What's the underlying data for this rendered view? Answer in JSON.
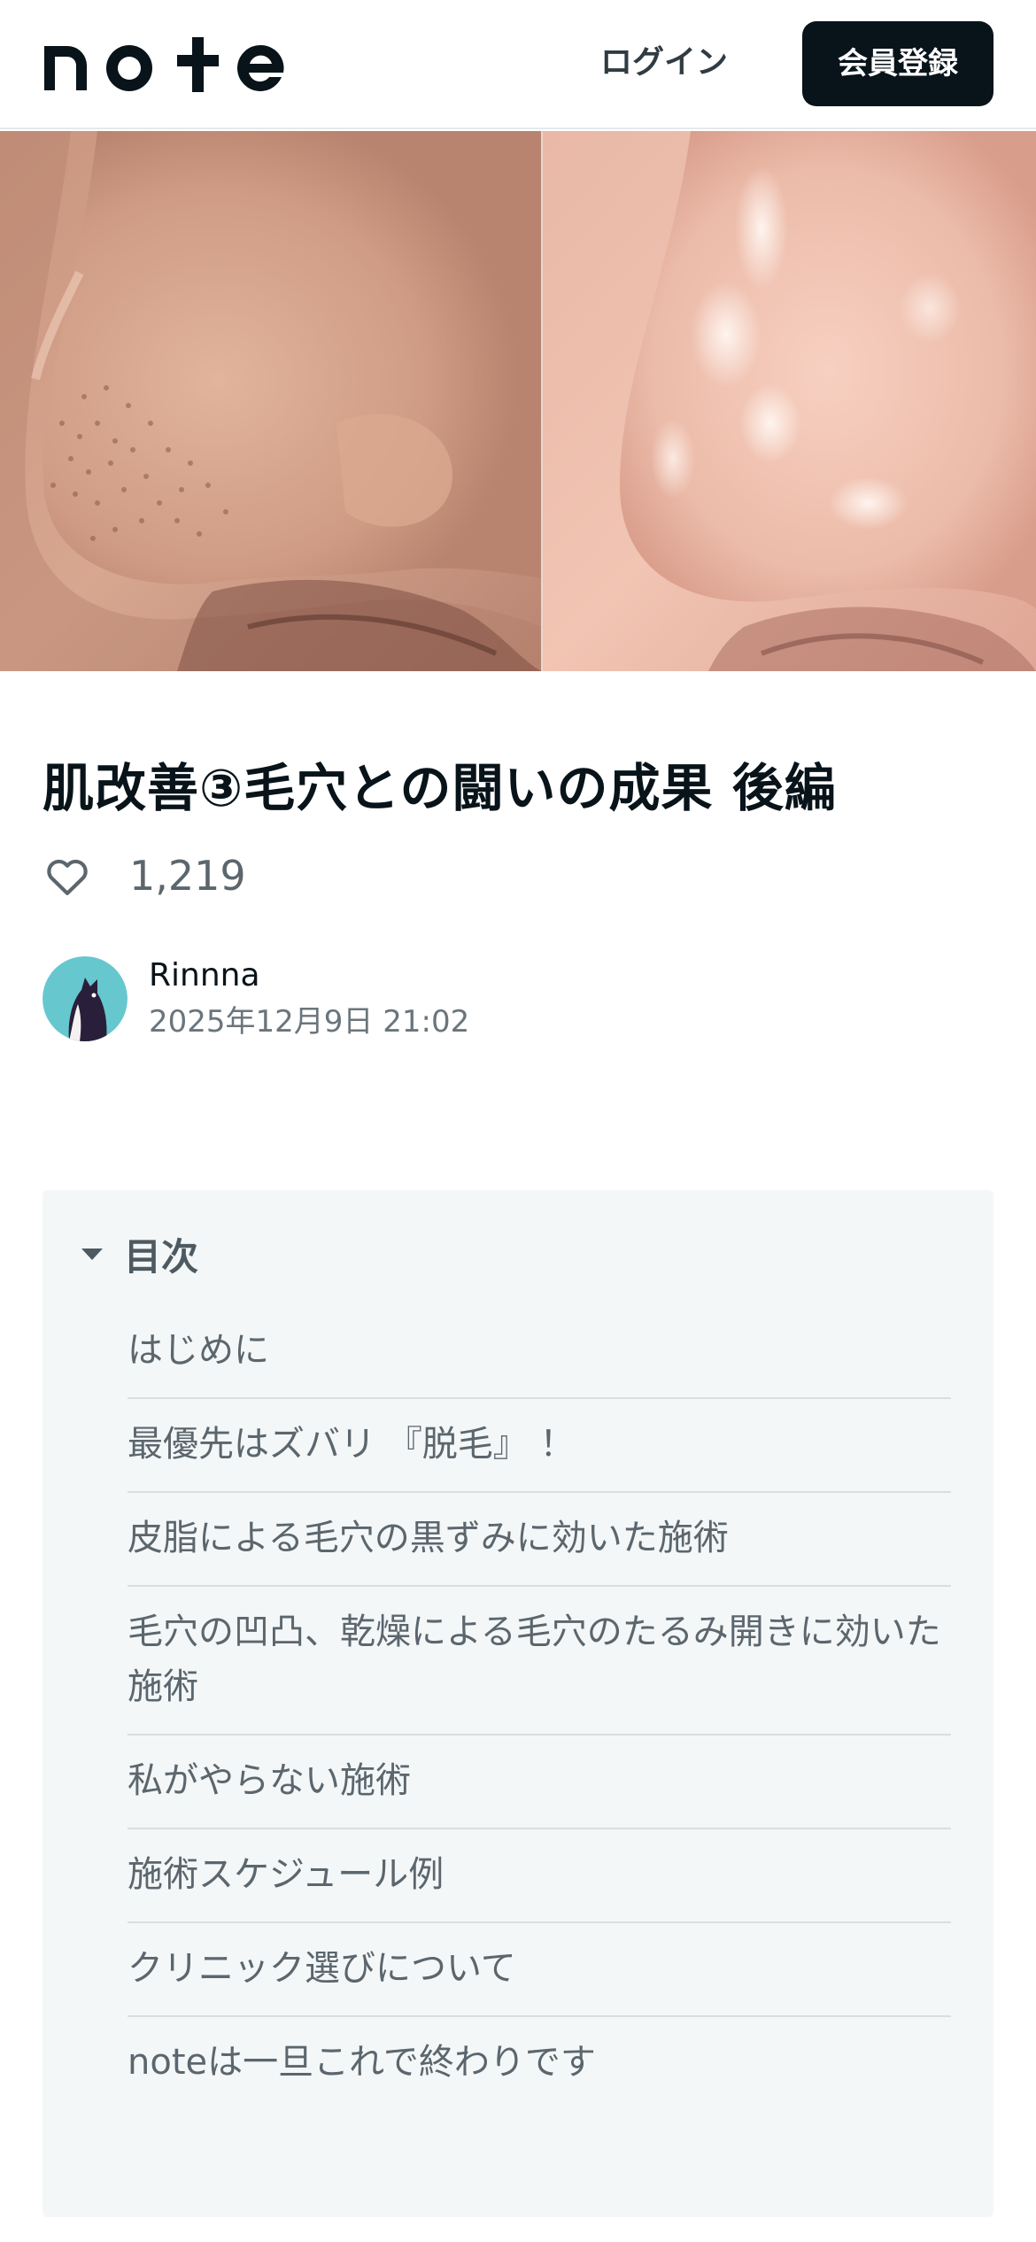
{
  "header": {
    "logo_text": "note",
    "login_label": "ログイン",
    "signup_label": "会員登録"
  },
  "hero": {
    "description_icon": "nose-before-after-photo"
  },
  "article": {
    "title": "肌改善③毛穴との闘いの成果 後編",
    "like_count": "1,219",
    "author_name": "Rinnna",
    "published": "2025年12月9日 21:02"
  },
  "toc": {
    "title": "目次",
    "items": [
      "はじめに",
      "最優先はズバリ 『脱毛』 ！",
      "皮脂による毛穴の黒ずみに効いた施術",
      "毛穴の凹凸、乾燥による毛穴のたるみ開きに効いた施術",
      "私がやらない施術",
      "施術スケジュール例",
      "クリニック選びについて",
      "noteは一旦これで終わりです"
    ]
  },
  "colors": {
    "brand_dark": "#08131a",
    "toc_bg": "#f4f7f8",
    "avatar_bg": "#66c7cf"
  }
}
